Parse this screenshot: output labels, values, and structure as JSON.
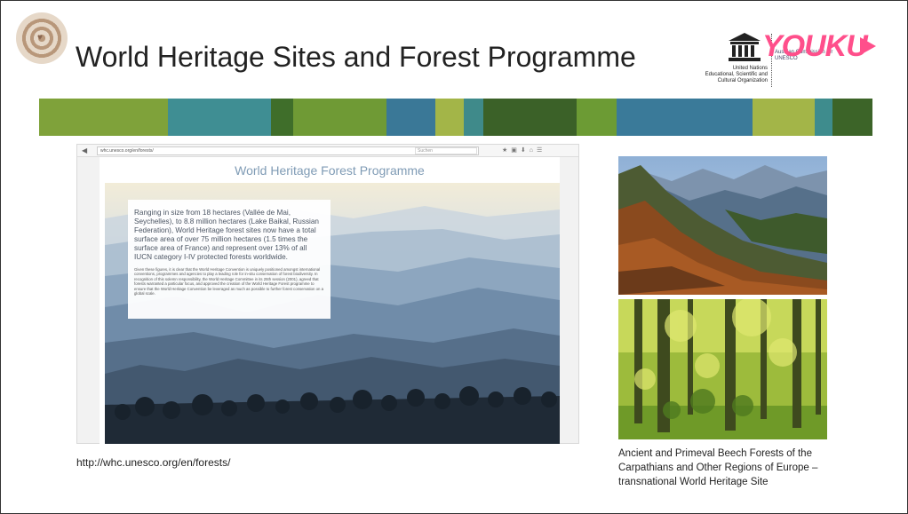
{
  "slide": {
    "title": "World Heritage Sites and Forest Programme",
    "url_caption": "http://whc.unesco.org/en/forests/",
    "photo_caption": "Ancient and Primeval Beech Forests of the Carpathians and Other Regions of Europe – transnational World Heritage Site"
  },
  "logos": {
    "unesco_org": "United Nations Educational, Scientific and Cultural Organization",
    "austrian_commission": "Austrian Commission for UNESCO",
    "watermark": "YOUKU"
  },
  "browser": {
    "url": "whc.unesco.org/en/forests/",
    "search_placeholder": "Suchen"
  },
  "webpage": {
    "title": "World Heritage Forest Programme",
    "lead_text": "Ranging in size from 18 hectares (Vallée de Mai, Seychelles), to 8.8 million hectares (Lake Baikal, Russian Federation), World Heritage forest sites now have a total surface area of over 75 million hectares (1.5 times the surface area of France) and represent over 13% of all IUCN category I-IV protected forests worldwide.",
    "body_text": "Given these figures, it is clear that the World Heritage Convention is uniquely positioned amongst international conventions, programmes and agencies to play a leading role for in-situ conservation of forest biodiversity. In recognition of this solemn responsibility, the World Heritage Committee in its 25th session (2001), agreed that forests warranted a particular focus, and approved the creation of the World Heritage Forest programme to ensure that the World Heritage Convention be leveraged as much as possible to further forest conservation on a global scale."
  },
  "colors": {
    "stripe": [
      "#7fa23a",
      "#3f8e93",
      "#3f6e2a",
      "#6f9a35",
      "#3a7897",
      "#a3b548",
      "#3f8a8a",
      "#3b6128",
      "#6c9b34",
      "#3a7a99",
      "#a3b548",
      "#3e8c8d",
      "#3c6428"
    ],
    "title_text": "#222222",
    "webpage_title": "#7f9bb5"
  }
}
